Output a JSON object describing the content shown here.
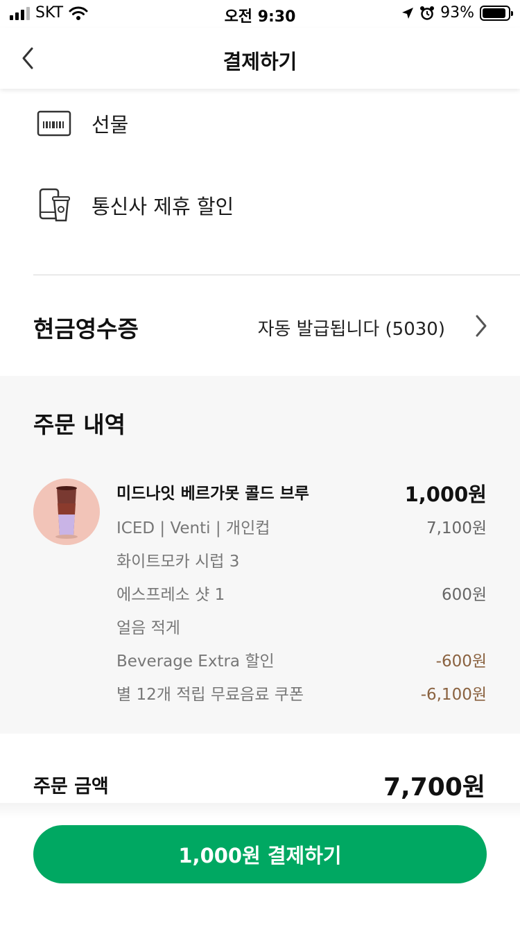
{
  "status_bar": {
    "carrier": "SKT",
    "time": "오전 9:30",
    "battery": "93%",
    "battery_level": 0.93
  },
  "header": {
    "title": "결제하기",
    "back_icon": "chevron-left-icon"
  },
  "payment_options": [
    {
      "label": "선물",
      "icon": "gift-card-icon"
    },
    {
      "label": "통신사 제휴 할인",
      "icon": "phone-cup-icon"
    }
  ],
  "cash_receipt": {
    "title": "현금영수증",
    "value": "자동 발급됩니다 (5030)"
  },
  "order": {
    "title": "주문 내역",
    "item": {
      "name": "미드나잇 베르가못 콜드 브루",
      "price": "1,000원",
      "details": [
        {
          "label": "ICED | Venti | 개인컵",
          "amount": "7,100원"
        },
        {
          "label": "화이트모카 시럽 3",
          "amount": ""
        },
        {
          "label": "에스프레소 샷 1",
          "amount": "600원"
        },
        {
          "label": "얼음 적게",
          "amount": ""
        },
        {
          "label": "Beverage Extra 할인",
          "amount": "-600원"
        },
        {
          "label": "별 12개 적립 무료음료 쿠폰",
          "amount": "-6,100원"
        }
      ]
    }
  },
  "total": {
    "label": "주문 금액",
    "value": "7,700원"
  },
  "pay_button": {
    "label": "1,000원 결제하기"
  },
  "colors": {
    "accent": "#00a862",
    "discount": "#8a6240",
    "section_bg": "#f7f7f7"
  }
}
